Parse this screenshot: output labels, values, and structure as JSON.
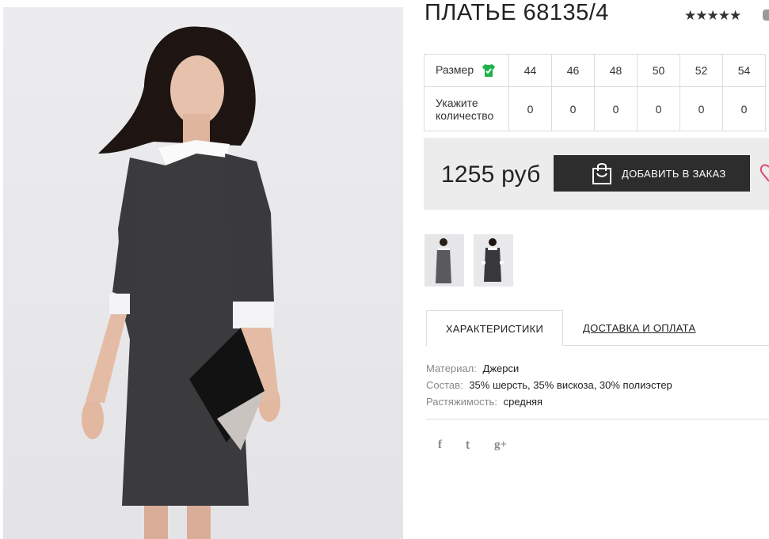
{
  "product": {
    "title": "ПЛАТЬЕ 68135/4",
    "rating_stars": "★★★★★"
  },
  "size_table": {
    "size_label": "Размер",
    "qty_label": "Укажите количество",
    "sizes": [
      "44",
      "46",
      "48",
      "50",
      "52",
      "54"
    ],
    "quantities": [
      "0",
      "0",
      "0",
      "0",
      "0",
      "0"
    ]
  },
  "purchase": {
    "price": "1255 руб",
    "order_button_label": "ДОБАВИТЬ В ЗАКАЗ"
  },
  "tabs": {
    "characteristics": "ХАРАКТЕРИСТИКИ",
    "delivery": "ДОСТАВКА И ОПЛАТА"
  },
  "specs": [
    {
      "key": "Материал:",
      "value": "Джерси"
    },
    {
      "key": "Состав:",
      "value": "35% шерсть, 35% вискоза, 30% полиэстер"
    },
    {
      "key": "Растяжимость:",
      "value": "средняя"
    }
  ],
  "social": {
    "facebook": "f",
    "twitter": "t",
    "google_plus": "g+"
  },
  "colors": {
    "size_icon_green": "#1fb24a",
    "button_dark": "#2d2d2d",
    "heart_pink": "#d94a6a"
  },
  "icons": [
    "shirt-check-icon",
    "shopping-bag-icon",
    "heart-icon",
    "facebook-icon",
    "twitter-icon",
    "google-plus-icon"
  ]
}
